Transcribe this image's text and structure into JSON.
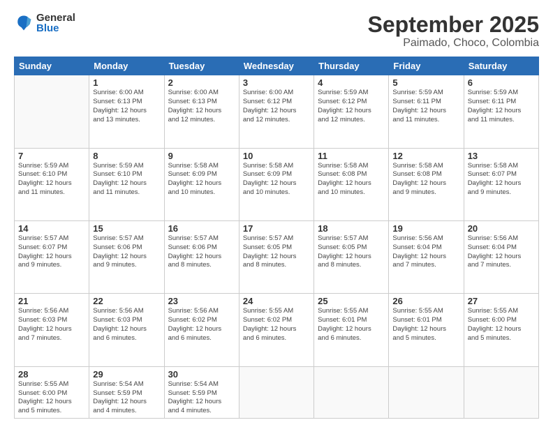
{
  "logo": {
    "general": "General",
    "blue": "Blue"
  },
  "header": {
    "month": "September 2025",
    "location": "Paimado, Choco, Colombia"
  },
  "weekdays": [
    "Sunday",
    "Monday",
    "Tuesday",
    "Wednesday",
    "Thursday",
    "Friday",
    "Saturday"
  ],
  "weeks": [
    [
      {
        "day": null
      },
      {
        "day": 1,
        "sunrise": "6:00 AM",
        "sunset": "6:13 PM",
        "daylight": "12 hours and 13 minutes."
      },
      {
        "day": 2,
        "sunrise": "6:00 AM",
        "sunset": "6:13 PM",
        "daylight": "12 hours and 12 minutes."
      },
      {
        "day": 3,
        "sunrise": "6:00 AM",
        "sunset": "6:12 PM",
        "daylight": "12 hours and 12 minutes."
      },
      {
        "day": 4,
        "sunrise": "5:59 AM",
        "sunset": "6:12 PM",
        "daylight": "12 hours and 12 minutes."
      },
      {
        "day": 5,
        "sunrise": "5:59 AM",
        "sunset": "6:11 PM",
        "daylight": "12 hours and 11 minutes."
      },
      {
        "day": 6,
        "sunrise": "5:59 AM",
        "sunset": "6:11 PM",
        "daylight": "12 hours and 11 minutes."
      }
    ],
    [
      {
        "day": 7,
        "sunrise": "5:59 AM",
        "sunset": "6:10 PM",
        "daylight": "12 hours and 11 minutes."
      },
      {
        "day": 8,
        "sunrise": "5:59 AM",
        "sunset": "6:10 PM",
        "daylight": "12 hours and 11 minutes."
      },
      {
        "day": 9,
        "sunrise": "5:58 AM",
        "sunset": "6:09 PM",
        "daylight": "12 hours and 10 minutes."
      },
      {
        "day": 10,
        "sunrise": "5:58 AM",
        "sunset": "6:09 PM",
        "daylight": "12 hours and 10 minutes."
      },
      {
        "day": 11,
        "sunrise": "5:58 AM",
        "sunset": "6:08 PM",
        "daylight": "12 hours and 10 minutes."
      },
      {
        "day": 12,
        "sunrise": "5:58 AM",
        "sunset": "6:08 PM",
        "daylight": "12 hours and 9 minutes."
      },
      {
        "day": 13,
        "sunrise": "5:58 AM",
        "sunset": "6:07 PM",
        "daylight": "12 hours and 9 minutes."
      }
    ],
    [
      {
        "day": 14,
        "sunrise": "5:57 AM",
        "sunset": "6:07 PM",
        "daylight": "12 hours and 9 minutes."
      },
      {
        "day": 15,
        "sunrise": "5:57 AM",
        "sunset": "6:06 PM",
        "daylight": "12 hours and 9 minutes."
      },
      {
        "day": 16,
        "sunrise": "5:57 AM",
        "sunset": "6:06 PM",
        "daylight": "12 hours and 8 minutes."
      },
      {
        "day": 17,
        "sunrise": "5:57 AM",
        "sunset": "6:05 PM",
        "daylight": "12 hours and 8 minutes."
      },
      {
        "day": 18,
        "sunrise": "5:57 AM",
        "sunset": "6:05 PM",
        "daylight": "12 hours and 8 minutes."
      },
      {
        "day": 19,
        "sunrise": "5:56 AM",
        "sunset": "6:04 PM",
        "daylight": "12 hours and 7 minutes."
      },
      {
        "day": 20,
        "sunrise": "5:56 AM",
        "sunset": "6:04 PM",
        "daylight": "12 hours and 7 minutes."
      }
    ],
    [
      {
        "day": 21,
        "sunrise": "5:56 AM",
        "sunset": "6:03 PM",
        "daylight": "12 hours and 7 minutes."
      },
      {
        "day": 22,
        "sunrise": "5:56 AM",
        "sunset": "6:03 PM",
        "daylight": "12 hours and 6 minutes."
      },
      {
        "day": 23,
        "sunrise": "5:56 AM",
        "sunset": "6:02 PM",
        "daylight": "12 hours and 6 minutes."
      },
      {
        "day": 24,
        "sunrise": "5:55 AM",
        "sunset": "6:02 PM",
        "daylight": "12 hours and 6 minutes."
      },
      {
        "day": 25,
        "sunrise": "5:55 AM",
        "sunset": "6:01 PM",
        "daylight": "12 hours and 6 minutes."
      },
      {
        "day": 26,
        "sunrise": "5:55 AM",
        "sunset": "6:01 PM",
        "daylight": "12 hours and 5 minutes."
      },
      {
        "day": 27,
        "sunrise": "5:55 AM",
        "sunset": "6:00 PM",
        "daylight": "12 hours and 5 minutes."
      }
    ],
    [
      {
        "day": 28,
        "sunrise": "5:55 AM",
        "sunset": "6:00 PM",
        "daylight": "12 hours and 5 minutes."
      },
      {
        "day": 29,
        "sunrise": "5:54 AM",
        "sunset": "5:59 PM",
        "daylight": "12 hours and 4 minutes."
      },
      {
        "day": 30,
        "sunrise": "5:54 AM",
        "sunset": "5:59 PM",
        "daylight": "12 hours and 4 minutes."
      },
      {
        "day": null
      },
      {
        "day": null
      },
      {
        "day": null
      },
      {
        "day": null
      }
    ]
  ]
}
